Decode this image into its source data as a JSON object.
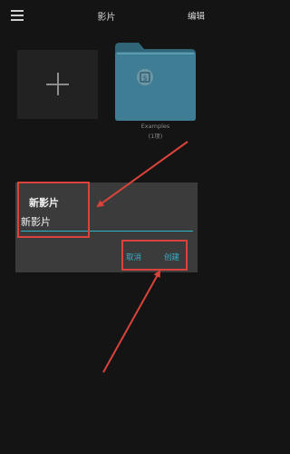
{
  "header": {
    "title": "影片",
    "edit_label": "编辑",
    "menu_icon": "hamburger-menu-icon"
  },
  "tiles": {
    "new_icon": "plus-icon",
    "folder": {
      "name": "Examples",
      "count": "(1项)",
      "icon": "folder-icon",
      "color": "#3e7d94"
    }
  },
  "dialog": {
    "title": "新影片",
    "input_value": "新影片",
    "cancel_label": "取消",
    "create_label": "创建",
    "accent": "#2fb5c9"
  },
  "annotation": {
    "color": "#d9433b"
  }
}
